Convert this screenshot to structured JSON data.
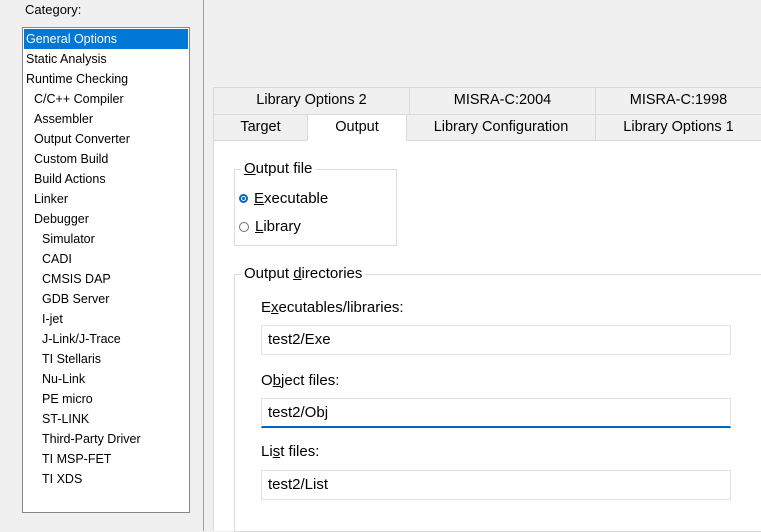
{
  "category": {
    "label": "Category:",
    "items": [
      {
        "label": "General Options",
        "level": 0,
        "selected": true
      },
      {
        "label": "Static Analysis",
        "level": 0
      },
      {
        "label": "Runtime Checking",
        "level": 0
      },
      {
        "label": "C/C++ Compiler",
        "level": 1
      },
      {
        "label": "Assembler",
        "level": 1
      },
      {
        "label": "Output Converter",
        "level": 1
      },
      {
        "label": "Custom Build",
        "level": 1
      },
      {
        "label": "Build Actions",
        "level": 1
      },
      {
        "label": "Linker",
        "level": 1
      },
      {
        "label": "Debugger",
        "level": 1
      },
      {
        "label": "Simulator",
        "level": 2
      },
      {
        "label": "CADI",
        "level": 2
      },
      {
        "label": "CMSIS DAP",
        "level": 2
      },
      {
        "label": "GDB Server",
        "level": 2
      },
      {
        "label": "I-jet",
        "level": 2
      },
      {
        "label": "J-Link/J-Trace",
        "level": 2
      },
      {
        "label": "TI Stellaris",
        "level": 2
      },
      {
        "label": "Nu-Link",
        "level": 2
      },
      {
        "label": "PE micro",
        "level": 2
      },
      {
        "label": "ST-LINK",
        "level": 2
      },
      {
        "label": "Third-Party Driver",
        "level": 2
      },
      {
        "label": "TI MSP-FET",
        "level": 2
      },
      {
        "label": "TI XDS",
        "level": 2
      }
    ]
  },
  "tabs": {
    "row1": [
      "Library Options 2",
      "MISRA-C:2004",
      "MISRA-C:1998"
    ],
    "row2": [
      "Target",
      "Output",
      "Library Configuration",
      "Library Options 1"
    ],
    "active": "Output"
  },
  "output_file": {
    "title_pre": "",
    "title_accel": "O",
    "title_post": "utput file",
    "executable": {
      "accel": "E",
      "rest": "xecutable",
      "checked": true
    },
    "library": {
      "accel": "L",
      "rest": "ibrary",
      "checked": false
    }
  },
  "output_dirs": {
    "title_pre": "Output ",
    "title_accel": "d",
    "title_post": "irectories",
    "exe_label": {
      "pre": "E",
      "accel": "x",
      "post": "ecutables/libraries:"
    },
    "exe_value": "test2/Exe",
    "obj_label": {
      "pre": "O",
      "accel": "b",
      "post": "ject files:"
    },
    "obj_value": "test2/Obj",
    "list_label": {
      "pre": "Li",
      "accel": "s",
      "post": "t files:"
    },
    "list_value": "test2/List"
  },
  "colors": {
    "selection": "#0078d7",
    "accent": "#0067c0"
  }
}
